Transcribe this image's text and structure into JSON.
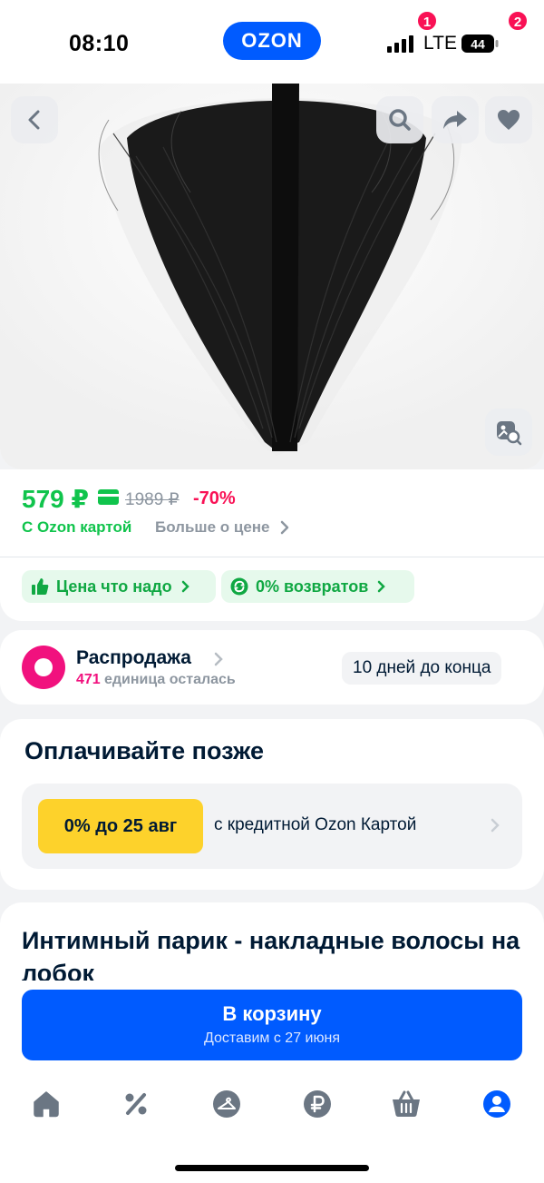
{
  "status_bar": {
    "time": "08:10",
    "brand": "OZON",
    "network": "LTE",
    "battery": "44"
  },
  "gallery": {
    "image_alt": "black hair product image",
    "buttons": [
      "back-icon",
      "search-icon",
      "share-icon",
      "heart-icon",
      "visual-search-icon"
    ]
  },
  "price": {
    "current": "579 ₽",
    "old": "1989 ₽",
    "discount": "-70%",
    "card_label": "С Ozon картой",
    "more_label": "Больше о цене",
    "accent_color": "#10c44c"
  },
  "badges": [
    {
      "label": "Цена что надо",
      "icon": "thumbs-up-icon"
    },
    {
      "label": "0% возвратов",
      "icon": "return-icon"
    }
  ],
  "sale": {
    "title": "Распродажа",
    "count": "471",
    "remaining_text": "единица осталась",
    "deadline": "10 дней до конца"
  },
  "pay_later": {
    "title": "Оплачивайте позже",
    "chip": "0% до 25 авг",
    "text": "с кредитной Ozon Картой"
  },
  "product": {
    "title": "Интимный парик - накладные волосы на лобок"
  },
  "cart": {
    "label": "В корзину",
    "delivery": "Доставим с 27 июня"
  },
  "tab_bar": {
    "cart_badge": "1",
    "profile_badge": "2",
    "accent_color": "#005bff"
  }
}
